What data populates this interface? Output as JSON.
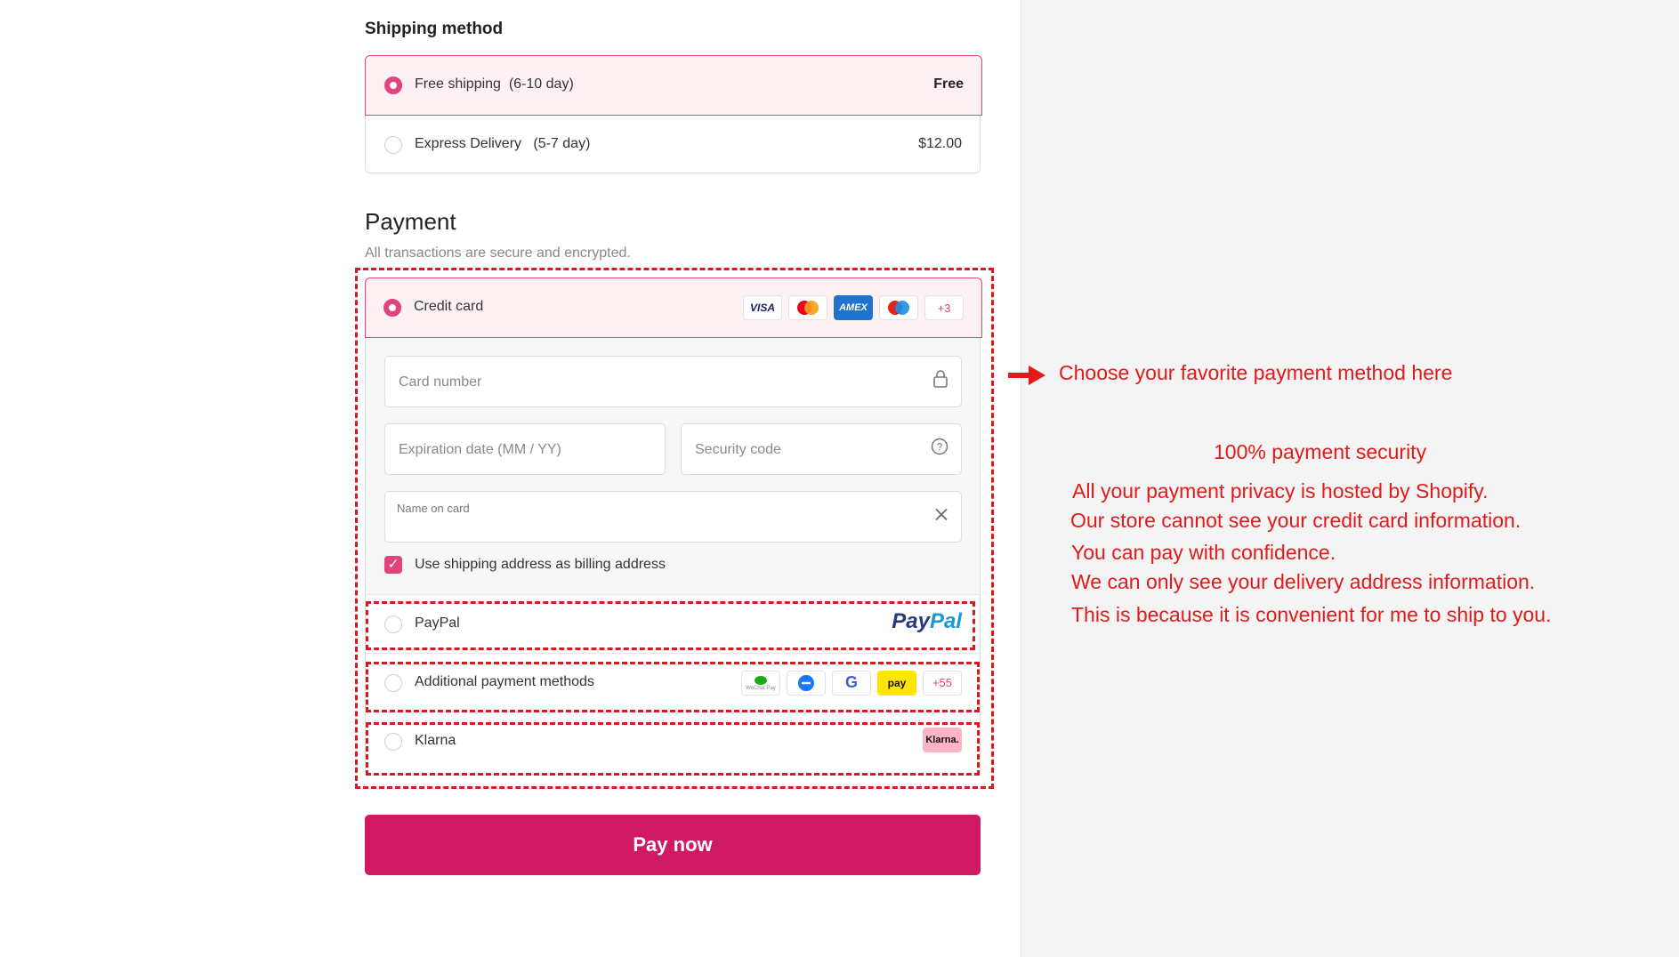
{
  "shipping": {
    "title": "Shipping method",
    "options": [
      {
        "label": "Free shipping",
        "time": "(6-10 day)",
        "price": "Free"
      },
      {
        "label": "Express Delivery",
        "time": "(5-7 day)",
        "price": "$12.00"
      }
    ]
  },
  "payment": {
    "title": "Payment",
    "subtitle": "All transactions are secure and encrypted.",
    "credit_card": {
      "label": "Credit card",
      "brands": [
        "VISA",
        "Mastercard",
        "AMEX",
        "Maestro"
      ],
      "more": "+3",
      "card_number_placeholder": "Card number",
      "expiration_placeholder": "Expiration date (MM / YY)",
      "security_placeholder": "Security code",
      "name_label": "Name on card",
      "billing_checkbox": "Use shipping address as billing address"
    },
    "paypal": {
      "label": "PayPal",
      "logo_text_1": "Pay",
      "logo_text_2": "Pal"
    },
    "additional": {
      "label": "Additional payment methods",
      "logos": [
        "WeChat Pay",
        "",
        "G",
        "pay"
      ],
      "more": "+55"
    },
    "klarna": {
      "label": "Klarna",
      "logo_text": "Klarna."
    }
  },
  "pay_button": "Pay now",
  "annotations": {
    "arrow_text": "Choose your favorite payment method here",
    "security_title": "100% payment security",
    "lines": [
      "All your payment privacy is hosted by Shopify.",
      "Our store cannot see your credit card information.",
      "You can pay with confidence.",
      "We can only see your delivery address information.",
      "This is because it is convenient for me to ship to you."
    ]
  },
  "colors": {
    "accent": "#e0447c",
    "button": "#d01a63",
    "annotation": "#e21a1a"
  }
}
